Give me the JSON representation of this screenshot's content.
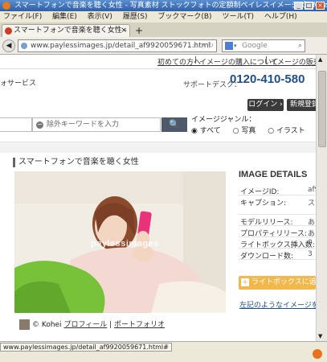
{
  "window": {
    "title": "スマートフォンで音楽を聴く女性 - 写真素材 ストックフォトの定額制ペイレスイメージズ - Mozilla Firefox"
  },
  "menu": [
    "ファイル(F)",
    "編集(E)",
    "表示(V)",
    "履歴(S)",
    "ブックマーク(B)",
    "ツール(T)",
    "ヘルプ(H)"
  ],
  "tab": {
    "label": "スマートフォンで音楽を聴く女性 - 写真素材 ス...",
    "close": "×",
    "new": "+"
  },
  "nav": {
    "url": "www.paylessimages.jp/detail_af9920059671.html",
    "search_placeholder": "Google"
  },
  "header": {
    "links": [
      "初めての方へ",
      "イメージの購入について",
      "イメージの販売"
    ],
    "brand": "ォサービス",
    "support_label": "サポートデスク：",
    "phone": "0120-410-580",
    "login": "ログイン",
    "register": "新規登録(無"
  },
  "search": {
    "exclude_placeholder": "除外キーワードを入力",
    "button": "🔍",
    "genre_label": "イメージジャンル：",
    "genres": [
      "すべて",
      "写真",
      "イラスト",
      "ベ"
    ]
  },
  "image": {
    "title": "スマートフォンで音楽を聴く女性",
    "watermark": "paylessimages",
    "credit_prefix": "© Kohei",
    "profile_link": "プロフィール",
    "portfolio_link": "ポートフォリオ"
  },
  "details": {
    "heading": "IMAGE DETAILS",
    "rows": [
      {
        "key": "イメージID:",
        "value": "af9"
      },
      {
        "key": "キャプション:",
        "value": "スマ"
      },
      {
        "key": "モデルリリース:",
        "value": "あり"
      },
      {
        "key": "プロパティリリース:",
        "value": "あり"
      },
      {
        "key": "ライトボックス挿入数:",
        "value": "0"
      },
      {
        "key": "ダウンロード数:",
        "value": "3"
      }
    ],
    "lightbox_button": "ライトボックスに追加",
    "similar_link": "左記のようなイメージを撮影し"
  },
  "status": {
    "url": "www.paylessimages.jp/detail_af9920059671.html#"
  }
}
